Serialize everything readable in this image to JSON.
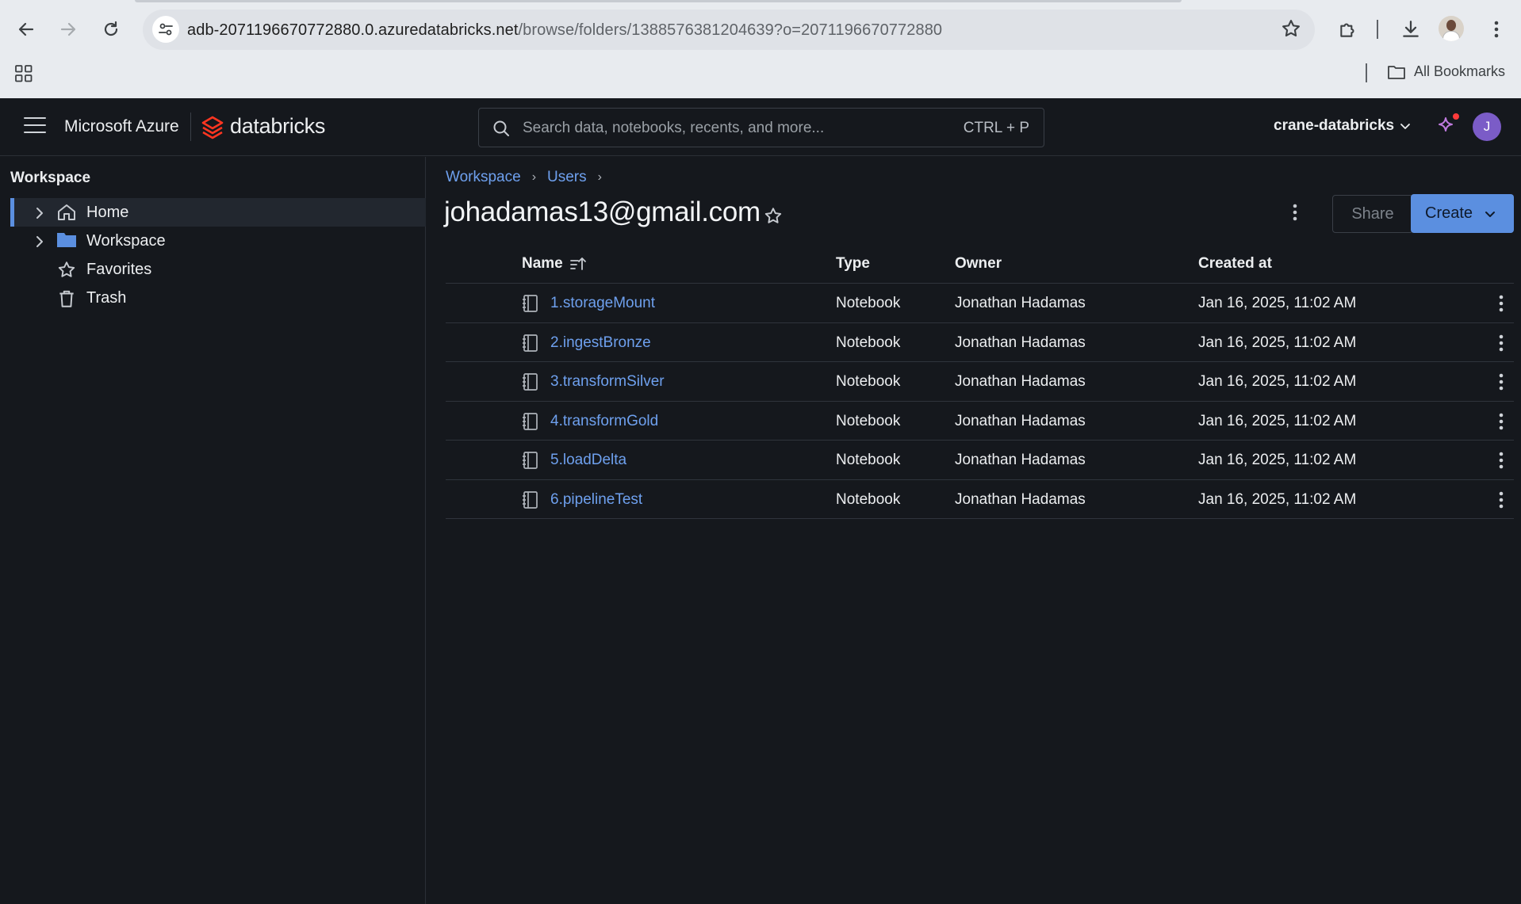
{
  "browser": {
    "url_host": "adb-2071196670772880.0.azuredatabricks.net",
    "url_path": "/browse/folders/1388576381204639?o=2071196670772880",
    "bookmarks_label": "All Bookmarks"
  },
  "topbar": {
    "microsoft_label": "Microsoft Azure",
    "product_label": "databricks",
    "search_placeholder": "Search data, notebooks, recents, and more...",
    "search_shortcut": "CTRL + P",
    "workspace_name": "crane-databricks",
    "user_initial": "J"
  },
  "sidebar": {
    "title": "Workspace",
    "items": [
      {
        "label": "Home",
        "icon": "home-icon",
        "expandable": true,
        "active": true
      },
      {
        "label": "Workspace",
        "icon": "folder-icon",
        "expandable": true,
        "active": false
      },
      {
        "label": "Favorites",
        "icon": "star-icon",
        "expandable": false,
        "active": false
      },
      {
        "label": "Trash",
        "icon": "trash-icon",
        "expandable": false,
        "active": false
      }
    ]
  },
  "main": {
    "breadcrumb": [
      "Workspace",
      "Users"
    ],
    "title": "johadamas13@gmail.com",
    "share_label": "Share",
    "create_label": "Create",
    "columns": {
      "name": "Name",
      "type": "Type",
      "owner": "Owner",
      "created": "Created at"
    },
    "rows": [
      {
        "name": "1.storageMount",
        "type": "Notebook",
        "owner": "Jonathan Hadamas",
        "created": "Jan 16, 2025, 11:02 AM"
      },
      {
        "name": "2.ingestBronze",
        "type": "Notebook",
        "owner": "Jonathan Hadamas",
        "created": "Jan 16, 2025, 11:02 AM"
      },
      {
        "name": "3.transformSilver",
        "type": "Notebook",
        "owner": "Jonathan Hadamas",
        "created": "Jan 16, 2025, 11:02 AM"
      },
      {
        "name": "4.transformGold",
        "type": "Notebook",
        "owner": "Jonathan Hadamas",
        "created": "Jan 16, 2025, 11:02 AM"
      },
      {
        "name": "5.loadDelta",
        "type": "Notebook",
        "owner": "Jonathan Hadamas",
        "created": "Jan 16, 2025, 11:02 AM"
      },
      {
        "name": "6.pipelineTest",
        "type": "Notebook",
        "owner": "Jonathan Hadamas",
        "created": "Jan 16, 2025, 11:02 AM"
      }
    ]
  },
  "colors": {
    "accent": "#5b8fe0",
    "link": "#6ea0ee",
    "background": "#15181d",
    "brand_red": "#ff3621"
  }
}
